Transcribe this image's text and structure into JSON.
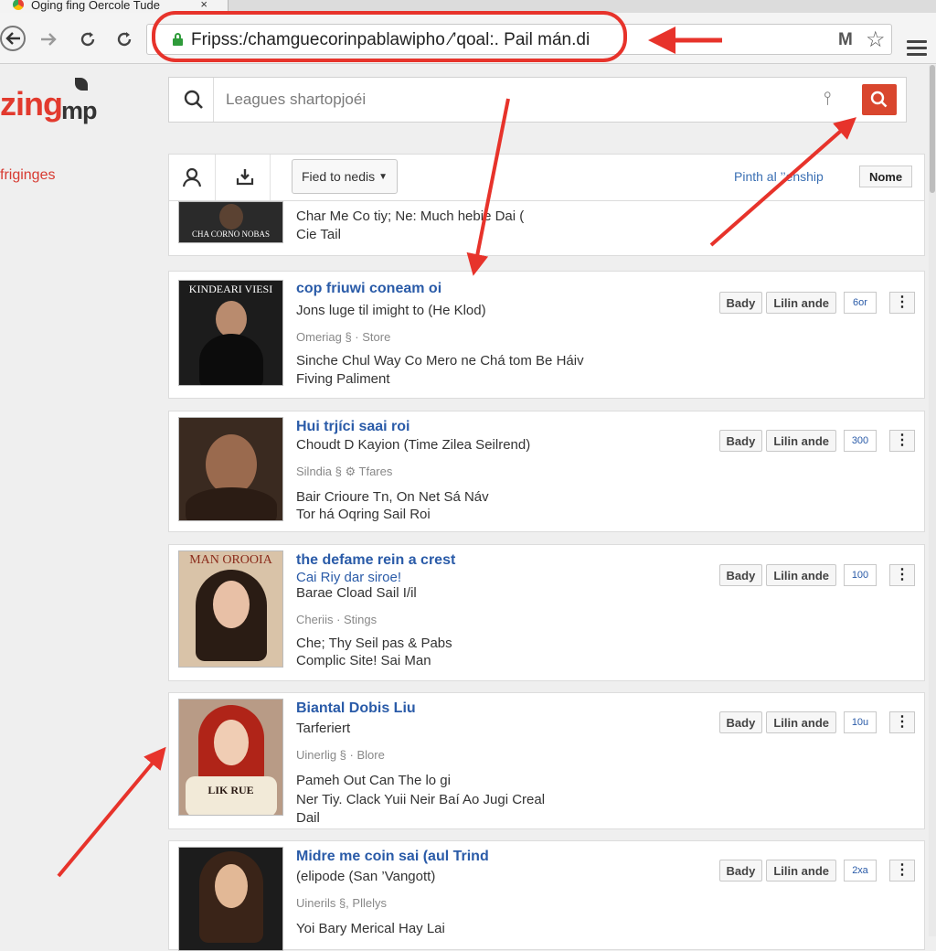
{
  "browser": {
    "tab_title": "Oging fing Oercole Tude",
    "tab_close": "×",
    "url": "Fripss:/chamguecorinpablawipho ⁄’qoal:. Pail mán.di",
    "omnibox_extension": "M"
  },
  "site": {
    "logo_main": "zing",
    "logo_sub": "mp",
    "sidenav_item": "friginɡes"
  },
  "search": {
    "placeholder": "Leagues shartopjoéi"
  },
  "filterbar": {
    "dropdown_label": "Fied to nedis",
    "link_text": "Pinth al ’’enship",
    "button_label": "Nome"
  },
  "rows": [
    {
      "title": "",
      "line1": "Char Me Co tiy; Ne: Much hebie Dai (",
      "line2": "Cie Tail",
      "thumb_caption": "CHA CORNO NOBAS"
    },
    {
      "title": "cop friuwi coneam oi",
      "subtitle": "Jons luge til imight to (He Klod)",
      "meta": "Omeriag § · Store",
      "desc1": "Sinche Chul Way Co Mero ne Chá tom Be Háiv",
      "desc2": "Fiving Paliment",
      "thumb_caption": "KINDEARI VIESI",
      "btn1": "Bady",
      "btn2": "Lilin ande",
      "count": "6or",
      "more": "⋮"
    },
    {
      "title": "Hui trjíci saai roi",
      "subtitle": "Choudt D Kayion (Time Zilea Seilrend)",
      "meta": "Silndia § ⚙ Tfares",
      "desc1": "Bair Crioure Tn, On Net Sá Náv",
      "desc2": "Tor há Oqring Sail Roi",
      "btn1": "Bady",
      "btn2": "Lilin ande",
      "count": "300",
      "more": "⋮"
    },
    {
      "title": "the defame rein a crest",
      "subtitle": "Cai Riy dar siroe!",
      "subtitle2": "Barae Cload Sail I/il",
      "meta": "Cheriis · Stings",
      "desc1": "Che; Thy Seil pas & Pabs",
      "desc2": "Complic Site! Sai Man",
      "thumb_caption": "MAN OROOIA",
      "btn1": "Bady",
      "btn2": "Lilin ande",
      "count": "100",
      "more": "⋮"
    },
    {
      "title": "Biantal Dobis Liu",
      "subtitle": "Tarferiert",
      "meta": "Uinerlig § · Blore",
      "desc1": "Pameh Out Can The lo gi",
      "desc2": "Ner Tiy. Clack Yuii Neir Baí Ao Jugi Creal",
      "desc3": "Dail",
      "thumb_caption": "LIK RUE",
      "btn1": "Bady",
      "btn2": "Lilin ande",
      "count": "10u",
      "more": "⋮"
    },
    {
      "title": "Midre me coin sai (aul Trind",
      "subtitle": "(elipode (San ’Vangott)",
      "meta": "Uinerils §, Pllelys",
      "desc1": "Yoi Bary Merical Hay Lai",
      "btn1": "Bady",
      "btn2": "Lilin ande",
      "count": "2ха",
      "more": "⋮"
    }
  ],
  "colors": {
    "accent_red": "#e7332b",
    "link_blue": "#2a5ba8",
    "search_button": "#d9462e"
  }
}
